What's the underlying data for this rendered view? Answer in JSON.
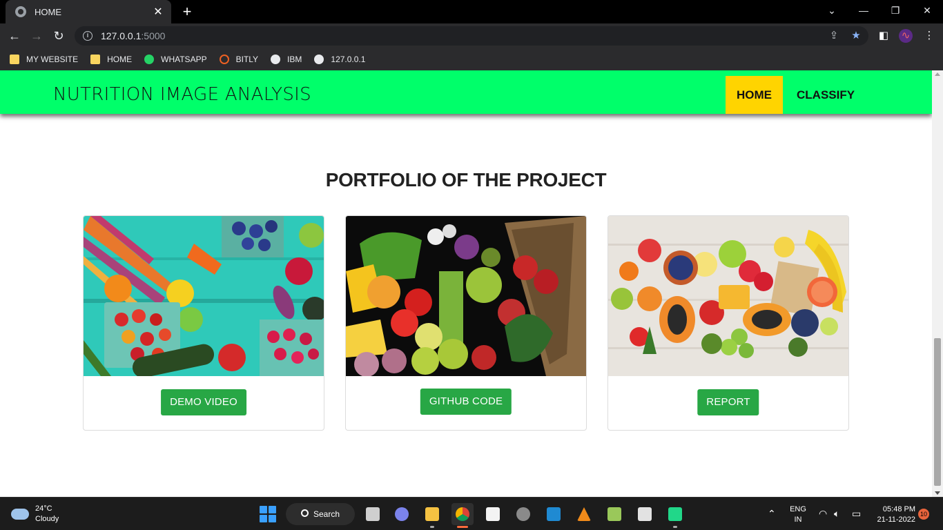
{
  "browser": {
    "tab_title": "HOME",
    "new_tab_symbol": "+",
    "address_host": "127.0.0.1",
    "address_port": ":5000",
    "bookmarks": [
      {
        "label": "MY WEBSITE",
        "icon": "folder-icon"
      },
      {
        "label": "HOME",
        "icon": "folder-icon"
      },
      {
        "label": "WHATSAPP",
        "icon": "whatsapp-icon"
      },
      {
        "label": "BITLY",
        "icon": "bitly-icon"
      },
      {
        "label": "IBM",
        "icon": "globe-icon"
      },
      {
        "label": "127.0.0.1",
        "icon": "globe-icon"
      }
    ]
  },
  "site": {
    "brand": "NUTRITION IMAGE ANALYSIS",
    "nav": [
      {
        "label": "HOME",
        "active": true,
        "color": "#ffd400"
      },
      {
        "label": "CLASSIFY",
        "active": false
      }
    ],
    "navbar_color": "#00ff6a",
    "section_title": "PORTFOLIO OF THE PROJECT",
    "cards": [
      {
        "image": "vegetables-on-teal-table-photo",
        "button": "DEMO VIDEO"
      },
      {
        "image": "vegetable-crate-photo",
        "button": "GITHUB CODE"
      },
      {
        "image": "fruit-platter-photo",
        "button": "REPORT"
      }
    ],
    "button_color": "#28a745"
  },
  "taskbar": {
    "weather_temp": "24°C",
    "weather_desc": "Cloudy",
    "search_label": "Search",
    "lang": "ENG",
    "region": "IN",
    "time": "05:48 PM",
    "date": "21-11-2022",
    "notifications": "10"
  }
}
